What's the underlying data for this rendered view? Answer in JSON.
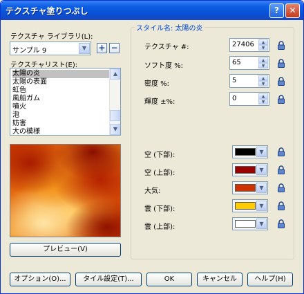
{
  "window": {
    "title": "テクスチャ塗りつぶし",
    "help_glyph": "?",
    "close_glyph": "✕"
  },
  "library": {
    "label": "テクスチャ ライブラリ(L):",
    "value": "サンプル 9",
    "add_glyph": "+",
    "remove_glyph": "−"
  },
  "texture_list": {
    "label": "テクスチャリスト(E):",
    "items": [
      "太陽の炎",
      "太陽の表面",
      "虹色",
      "風船ガム",
      "噴火",
      "泡",
      "妨害",
      "大の模様"
    ],
    "selected_index": 0
  },
  "preview_button": "プレビュー(V)",
  "style": {
    "group_title": "スタイル名: 太陽の炎",
    "params": [
      {
        "label": "テクスチャ #:",
        "value": "27406"
      },
      {
        "label": "ソフト度 %:",
        "value": "65"
      },
      {
        "label": "密度 %:",
        "value": "5"
      },
      {
        "label": "輝度 ±%:",
        "value": "0"
      }
    ],
    "colors": [
      {
        "label": "空 (下部):",
        "color": "#000000"
      },
      {
        "label": "空 (上部):",
        "color": "#990000"
      },
      {
        "label": "大気:",
        "color": "#cc3300"
      },
      {
        "label": "雲 (下部):",
        "color": "#ffcc00"
      },
      {
        "label": "雲 (上部):",
        "color": "#ffffff"
      }
    ]
  },
  "footer": {
    "options": "オプション(O)...",
    "tile": "タイル設定(T)...",
    "ok": "OK",
    "cancel": "キャンセル",
    "help": "ヘルプ(H)"
  },
  "icons": {
    "lock": "lock-icon",
    "dropdown": "chevron-down-icon"
  }
}
